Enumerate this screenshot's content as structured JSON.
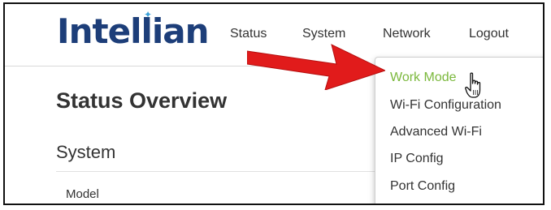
{
  "brand": {
    "logo_text": "Intellian"
  },
  "nav": {
    "items": [
      {
        "label": "Status"
      },
      {
        "label": "System"
      },
      {
        "label": "Network"
      },
      {
        "label": "Logout"
      }
    ]
  },
  "dropdown": {
    "items": [
      {
        "label": "Work Mode"
      },
      {
        "label": "Wi-Fi Configuration"
      },
      {
        "label": "Advanced Wi-Fi"
      },
      {
        "label": "IP Config"
      },
      {
        "label": "Port Config"
      }
    ]
  },
  "main": {
    "title": "Status Overview",
    "section_title": "System",
    "field_label": "Model"
  },
  "colors": {
    "brand": "#1d3e79",
    "highlight": "#7bb83c",
    "arrow": "#e11b1b"
  },
  "icons": {
    "annotation": "red-arrow-icon",
    "pointer": "hand-pointer-cursor-icon"
  }
}
